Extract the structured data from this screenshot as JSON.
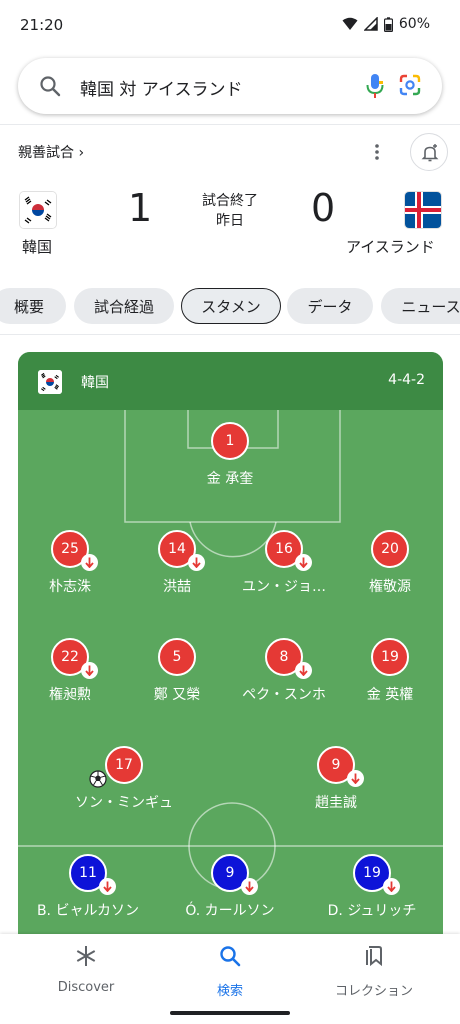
{
  "statusbar": {
    "time": "21:20",
    "battery": "60%"
  },
  "search": {
    "query": "韓国 対 アイスランド"
  },
  "match": {
    "type_label": "親善試合",
    "home": {
      "name": "韓国",
      "score": "1",
      "flag": "south-korea-flag"
    },
    "away": {
      "name": "アイスランド",
      "score": "0",
      "flag": "iceland-flag"
    },
    "status": "試合終了",
    "date": "昨日"
  },
  "tabs": [
    {
      "label": "概要",
      "active": false
    },
    {
      "label": "試合経過",
      "active": false
    },
    {
      "label": "スタメン",
      "active": true
    },
    {
      "label": "データ",
      "active": false
    },
    {
      "label": "ニュース",
      "active": false
    }
  ],
  "lineup": {
    "team": "韓国",
    "formation": "4-4-2",
    "players": [
      {
        "number": "1",
        "name": "金 承奎",
        "substituted": false,
        "scored": false,
        "team_color": "red"
      },
      {
        "number": "25",
        "name": "朴志洙",
        "substituted": true,
        "scored": false,
        "team_color": "red"
      },
      {
        "number": "14",
        "name": "洪喆",
        "substituted": true,
        "scored": false,
        "team_color": "red"
      },
      {
        "number": "16",
        "name": "ユン・ジョ…",
        "substituted": true,
        "scored": false,
        "team_color": "red"
      },
      {
        "number": "20",
        "name": "権敬源",
        "substituted": false,
        "scored": false,
        "team_color": "red"
      },
      {
        "number": "22",
        "name": "権昶勲",
        "substituted": true,
        "scored": false,
        "team_color": "red"
      },
      {
        "number": "5",
        "name": "鄭 又榮",
        "substituted": false,
        "scored": false,
        "team_color": "red"
      },
      {
        "number": "8",
        "name": "ペク・スンホ",
        "substituted": true,
        "scored": false,
        "team_color": "red"
      },
      {
        "number": "19",
        "name": "金 英權",
        "substituted": false,
        "scored": false,
        "team_color": "red"
      },
      {
        "number": "17",
        "name": "ソン・ミンギュ",
        "substituted": false,
        "scored": true,
        "team_color": "red"
      },
      {
        "number": "9",
        "name": "趙圭誠",
        "substituted": true,
        "scored": false,
        "team_color": "red"
      },
      {
        "number": "11",
        "name": "B. ビャルカソン",
        "substituted": true,
        "scored": false,
        "team_color": "blue"
      },
      {
        "number": "9",
        "name": "Ó. カールソン",
        "substituted": true,
        "scored": false,
        "team_color": "blue"
      },
      {
        "number": "19",
        "name": "D. ジュリッチ",
        "substituted": true,
        "scored": false,
        "team_color": "blue"
      }
    ]
  },
  "colors": {
    "pitch": "#5ba75e",
    "pitch_header": "#3d8a44",
    "red": "#e53935",
    "blue": "#0d13d8",
    "accent": "#1a73e8"
  },
  "nav": [
    {
      "label": "Discover",
      "icon": "asterisk-icon",
      "active": false
    },
    {
      "label": "検索",
      "icon": "search-icon",
      "active": true
    },
    {
      "label": "コレクション",
      "icon": "collections-icon",
      "active": false
    }
  ]
}
